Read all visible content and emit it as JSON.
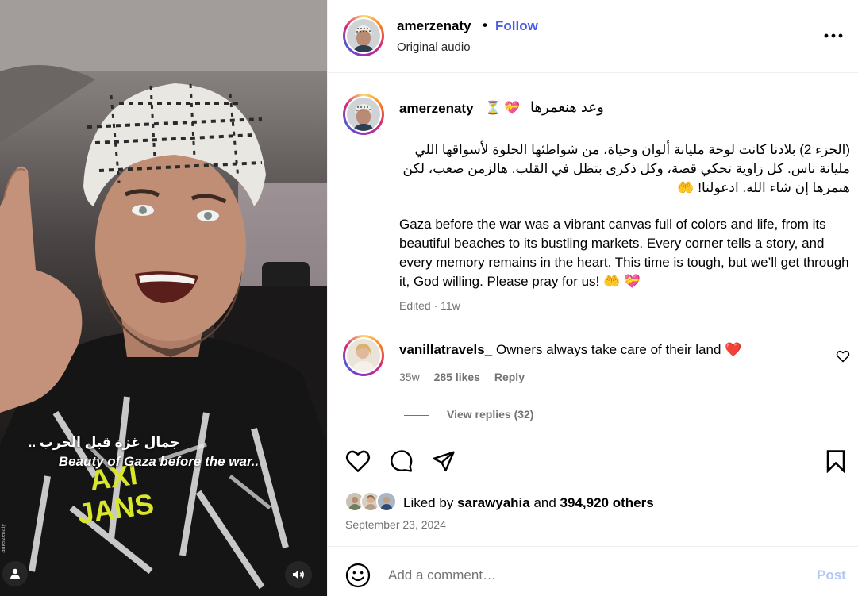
{
  "media": {
    "caption_arabic": "جمال غزة قبل الحرب ..",
    "caption_english": "Beauty of Gaza before the war..",
    "watermark": "amerzenaty",
    "shirt_text_top": "AXI",
    "shirt_text_bottom": "JANS"
  },
  "header": {
    "username": "amerzenaty",
    "separator": "•",
    "follow_label": "Follow",
    "audio_label": "Original audio"
  },
  "caption": {
    "username": "amerzenaty",
    "emoji": "⏳ 💝",
    "arabic_title": "وعد هنعمرها",
    "arabic_body": "(الجزء 2) بلادنا كانت لوحة مليانة ألوان وحياة، من شواطئها الحلوة لأسواقها اللي مليانة ناس. كل زاوية تحكي قصة، وكل ذكرى بتظل في القلب. هالزمن صعب، لكن هنمرها إن شاء الله. ادعولنا! 🤲",
    "english_body": "Gaza before the war was a vibrant canvas full of colors and life, from its beautiful beaches to its bustling markets. Every corner tells a story, and every memory remains in the heart. This time is tough, but we’ll get through it, God willing. Please pray for us! 🤲 💝",
    "meta": "Edited · 11w"
  },
  "comment": {
    "username": "vanillatravels_",
    "text": "Owners always take care of their land",
    "emoji": "❤️",
    "age": "35w",
    "likes": "285 likes",
    "reply_label": "Reply",
    "view_replies": "View replies (32)"
  },
  "actions": {
    "liked_prefix": "Liked by ",
    "liked_user": "sarawyahia",
    "liked_middle": " and ",
    "liked_count": "394,920 others",
    "date": "September 23, 2024"
  },
  "add_comment": {
    "placeholder": "Add a comment…",
    "post_label": "Post"
  },
  "colors": {
    "follow_blue": "#4a5ae8",
    "post_disabled": "#b2c9f7",
    "heart_pink": "#e8336b",
    "meta_gray": "#737373"
  }
}
